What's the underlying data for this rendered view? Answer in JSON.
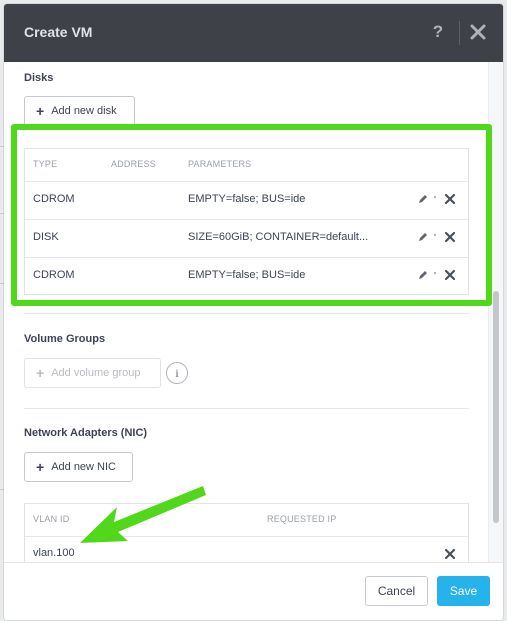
{
  "dialog": {
    "title": "Create VM",
    "help_glyph": "?"
  },
  "disks": {
    "section_label": "Disks",
    "add_button_label": "Add new disk",
    "columns": [
      "TYPE",
      "ADDRESS",
      "PARAMETERS"
    ],
    "rows": [
      {
        "type": "CDROM",
        "address": "",
        "parameters": "EMPTY=false; BUS=ide"
      },
      {
        "type": "DISK",
        "address": "",
        "parameters": "SIZE=60GiB; CONTAINER=default..."
      },
      {
        "type": "CDROM",
        "address": "",
        "parameters": "EMPTY=false; BUS=ide"
      }
    ]
  },
  "volume_groups": {
    "section_label": "Volume Groups",
    "add_button_label": "Add volume group",
    "info_glyph": "i"
  },
  "nics": {
    "section_label": "Network Adapters (NIC)",
    "add_button_label": "Add new NIC",
    "columns": [
      "VLAN ID",
      "REQUESTED IP"
    ],
    "rows": [
      {
        "vlan_id": "vlan.100",
        "requested_ip": ""
      }
    ]
  },
  "footer": {
    "cancel_label": "Cancel",
    "save_label": "Save"
  },
  "annotations": {
    "highlight_color": "#51d81a",
    "arrow_color": "#51d81a"
  },
  "colors": {
    "header_bg": "#3e4248",
    "save_button": "#26b3ec"
  }
}
